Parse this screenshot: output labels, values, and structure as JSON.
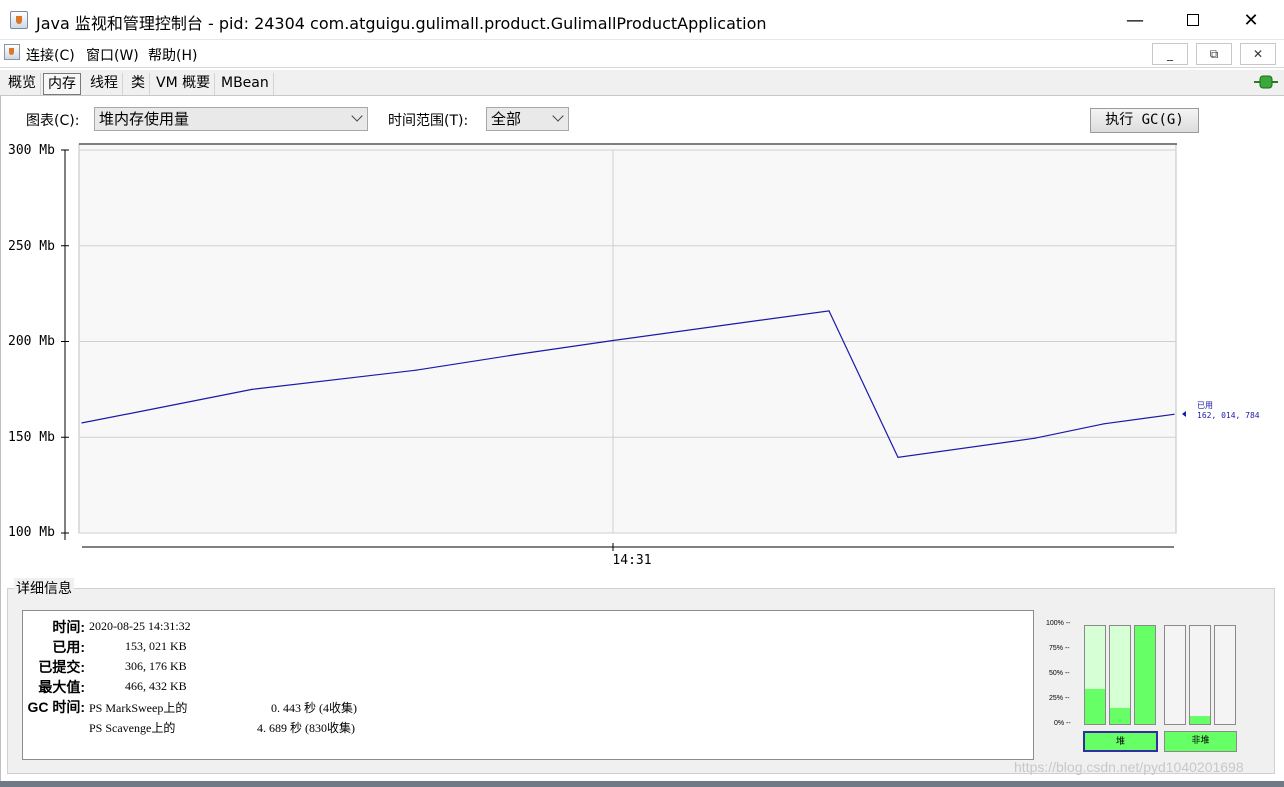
{
  "window": {
    "title": "Java 监视和管理控制台 - pid: 24304 com.atguigu.gulimall.product.GulimallProductApplication",
    "minimize_glyph": "—",
    "close_glyph": "✕"
  },
  "menu": {
    "items": [
      "连接(C)",
      "窗口(W)",
      "帮助(H)"
    ],
    "mdi_min": "_",
    "mdi_restore": "⧉",
    "mdi_close": "✕"
  },
  "tabs": [
    {
      "label": "概览",
      "active": false
    },
    {
      "label": "内存",
      "active": true
    },
    {
      "label": "线程",
      "active": false
    },
    {
      "label": "类",
      "active": false
    },
    {
      "label": "VM 概要",
      "active": false
    },
    {
      "label": "MBean",
      "active": false
    }
  ],
  "controls": {
    "chart_label": "图表(C):",
    "chart_selected": "堆内存使用量",
    "range_label": "时间范围(T):",
    "range_selected": "全部",
    "gc_button": "执行 GC(G)"
  },
  "chart_data": {
    "type": "line",
    "x": [
      "",
      "",
      "",
      "",
      "",
      "",
      "",
      "",
      "",
      "",
      "",
      ""
    ],
    "x_tick_label": "14:31",
    "series": [
      {
        "name": "",
        "color": "#1a1aa8",
        "values": [
          157.5,
          164,
          175,
          185,
          193,
          200.5,
          211,
          216,
          139.5,
          149.5,
          157,
          162
        ]
      }
    ],
    "y_ticks": [
      "300 Mb",
      "250 Mb",
      "200 Mb",
      "150 Mb",
      "100 Mb"
    ],
    "ylim": [
      100,
      300
    ],
    "grid": true,
    "legend_label": "已用",
    "legend_value": "162, 014, 784"
  },
  "details": {
    "title": "详细信息",
    "rows": [
      {
        "key": "时间:",
        "value": "2020-08-25 14:31:32"
      },
      {
        "key": "已用:",
        "value": "153, 021 KB"
      },
      {
        "key": "已提交:",
        "value": "306, 176 KB"
      },
      {
        "key": "最大值:",
        "value": "466, 432 KB"
      }
    ],
    "gc_key": "GC 时间:",
    "gc": [
      {
        "name": "PS MarkSweep上的",
        "time": "0. 443 秒 (4收集)"
      },
      {
        "name": "PS Scavenge上的",
        "time": "4. 689 秒 (830收集)"
      }
    ]
  },
  "pools": {
    "pct_labels": [
      "100% --",
      "75% --",
      "50% --",
      "25% --",
      "0% --"
    ],
    "heap_fills": [
      0.36,
      0.16,
      1.0
    ],
    "nonheap_fills": [
      0.0,
      0.08,
      0.0
    ],
    "heap_label": "堆",
    "nonheap_label": "非堆",
    "fill_color": "#66ff66"
  },
  "watermark": "https://blog.csdn.net/pyd1040201698"
}
